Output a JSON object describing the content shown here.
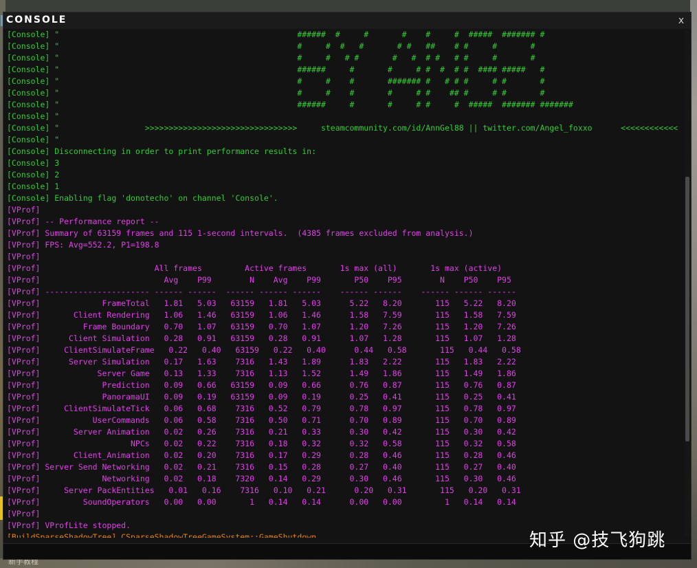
{
  "window": {
    "title": "CONSOLE",
    "close_label": "x"
  },
  "log_lines": [
    {
      "text": "[Console] \"                                                  ######  #     #       #    #     #  #####  ####### #",
      "color": "green"
    },
    {
      "text": "[Console] \"                                                  #     #  #   #       # #   ##    # #     #       #",
      "color": "green"
    },
    {
      "text": "[Console] \"                                                  #     #   # #       #   #  # #   # #     #       #",
      "color": "green"
    },
    {
      "text": "[Console] \"                                                  ######     #       #     # #  #  # #  #### #####   #",
      "color": "green"
    },
    {
      "text": "[Console] \"                                                  #     #    #       ####### #   # # #     # #       #",
      "color": "green"
    },
    {
      "text": "[Console] \"                                                  #     #    #       #     # #    ## #     # #       #",
      "color": "green"
    },
    {
      "text": "[Console] \"                                                  ######     #       #     # #     #  #####  ####### #######",
      "color": "green"
    },
    {
      "text": "[Console] \"",
      "color": "green"
    },
    {
      "text": "[Console] \"                  >>>>>>>>>>>>>>>>>>>>>>>>>>>>>>>>     steamcommunity.com/id/AnnGel88 || twitter.com/Angel_foxxo      <<<<<<<<<<<<",
      "color": "green"
    },
    {
      "text": "[Console] \"",
      "color": "green"
    },
    {
      "text": "[Console] Disconnecting in order to print performance results in:",
      "color": "green"
    },
    {
      "text": "[Console] 3",
      "color": "green"
    },
    {
      "text": "[Console] 2",
      "color": "green"
    },
    {
      "text": "[Console] 1",
      "color": "green"
    },
    {
      "text": "[Console] Enabling flag 'donotecho' on channel 'Console'.",
      "color": "green"
    },
    {
      "text": "[VProf]",
      "color": "magenta"
    },
    {
      "text": "[VProf] -- Performance report --",
      "color": "magenta"
    },
    {
      "text": "[VProf] Summary of 63159 frames and 115 1-second intervals.  (4385 frames excluded from analysis.)",
      "color": "magenta"
    },
    {
      "text": "[VProf] FPS: Avg=552.2, P1=198.8",
      "color": "magenta"
    },
    {
      "text": "[VProf]",
      "color": "magenta"
    },
    {
      "text": "[VProf]                        All frames         Active frames       1s max (all)       1s max (active)",
      "color": "magenta"
    },
    {
      "text": "[VProf]                          Avg    P99        N    Avg    P99       P50    P95        N    P50    P95",
      "color": "magenta"
    },
    {
      "text": "[VProf] ---------------------- ------ ------  ------ ------ ------    ------ ------    ------ ------ ------",
      "color": "magenta"
    },
    {
      "text": "[VProf]             FrameTotal   1.81   5.03   63159   1.81   5.03      5.22   8.20       115   5.22   8.20",
      "color": "magenta"
    },
    {
      "text": "[VProf]       Client Rendering   1.06   1.46   63159   1.06   1.46      1.58   7.59       115   1.58   7.59",
      "color": "magenta"
    },
    {
      "text": "[VProf]         Frame Boundary   0.70   1.07   63159   0.70   1.07      1.20   7.26       115   1.20   7.26",
      "color": "magenta"
    },
    {
      "text": "[VProf]      Client Simulation   0.28   0.91   63159   0.28   0.91      1.07   1.28       115   1.07   1.28",
      "color": "magenta"
    },
    {
      "text": "[VProf]     ClientSimulateFrame   0.22   0.40   63159   0.22   0.40      0.44   0.58       115   0.44   0.58",
      "color": "magenta"
    },
    {
      "text": "[VProf]      Server Simulation   0.17   1.63    7316   1.43   1.89      1.83   2.22       115   1.83   2.22",
      "color": "magenta"
    },
    {
      "text": "[VProf]            Server Game   0.13   1.33    7316   1.13   1.52      1.49   1.86       115   1.49   1.86",
      "color": "magenta"
    },
    {
      "text": "[VProf]             Prediction   0.09   0.66   63159   0.09   0.66      0.76   0.87       115   0.76   0.87",
      "color": "magenta"
    },
    {
      "text": "[VProf]             PanoramaUI   0.09   0.19   63159   0.09   0.19      0.25   0.41       115   0.25   0.41",
      "color": "magenta"
    },
    {
      "text": "[VProf]     ClientSimulateTick   0.06   0.68    7316   0.52   0.79      0.78   0.97       115   0.78   0.97",
      "color": "magenta"
    },
    {
      "text": "[VProf]           UserCommands   0.06   0.58    7316   0.50   0.71      0.70   0.89       115   0.70   0.89",
      "color": "magenta"
    },
    {
      "text": "[VProf]       Server Animation   0.02   0.26    7316   0.21   0.33      0.30   0.42       115   0.30   0.42",
      "color": "magenta"
    },
    {
      "text": "[VProf]                   NPCs   0.02   0.22    7316   0.18   0.32      0.32   0.58       115   0.32   0.58",
      "color": "magenta"
    },
    {
      "text": "[VProf]       Client_Animation   0.02   0.20    7316   0.17   0.29      0.28   0.46       115   0.28   0.46",
      "color": "magenta"
    },
    {
      "text": "[VProf] Server Send Networking   0.02   0.21    7316   0.15   0.28      0.27   0.40       115   0.27   0.40",
      "color": "magenta"
    },
    {
      "text": "[VProf]             Networking   0.02   0.18    7320   0.14   0.29      0.30   0.46       115   0.30   0.46",
      "color": "magenta"
    },
    {
      "text": "[VProf]     Server PackEntities   0.01   0.16    7316   0.10   0.21      0.20   0.31       115   0.20   0.31",
      "color": "magenta"
    },
    {
      "text": "[VProf]         SoundOperators   0.00   0.00       1   0.14   0.14      0.00   0.00         1   0.14   0.14",
      "color": "magenta"
    },
    {
      "text": "[VProf]",
      "color": "magenta"
    },
    {
      "text": "[VProf] VProfLite stopped.",
      "color": "magenta"
    },
    {
      "text": "[BuildSparseShadowTree] CSparseShadowTreeGameSystem::GameShutdown",
      "color": "orange"
    }
  ],
  "colors": {
    "green": "#33cc33",
    "magenta": "#e040e8",
    "orange": "#e8840a"
  },
  "input": {
    "value": "",
    "placeholder": ""
  },
  "watermark": "知乎 @技飞狗跳",
  "bottom_bar_text": "新手教程"
}
